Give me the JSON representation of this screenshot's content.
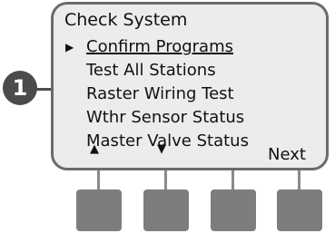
{
  "callout": {
    "number": "1"
  },
  "screen": {
    "title": "Check System",
    "cursor_icon": "▶",
    "items": [
      {
        "label": "Confirm Programs",
        "selected": true
      },
      {
        "label": "Test All Stations",
        "selected": false
      },
      {
        "label": "Raster Wiring Test",
        "selected": false
      },
      {
        "label": "Wthr Sensor Status",
        "selected": false
      },
      {
        "label": "Master Valve Status",
        "selected": false
      }
    ],
    "softkeys": {
      "up_icon": "▲",
      "down_icon": "▼",
      "next_label": "Next"
    }
  },
  "colors": {
    "lcd_background": "#ececec",
    "lcd_border": "#6b6b6b",
    "button": "#7d7d7d",
    "callout": "#4b4b4d"
  }
}
